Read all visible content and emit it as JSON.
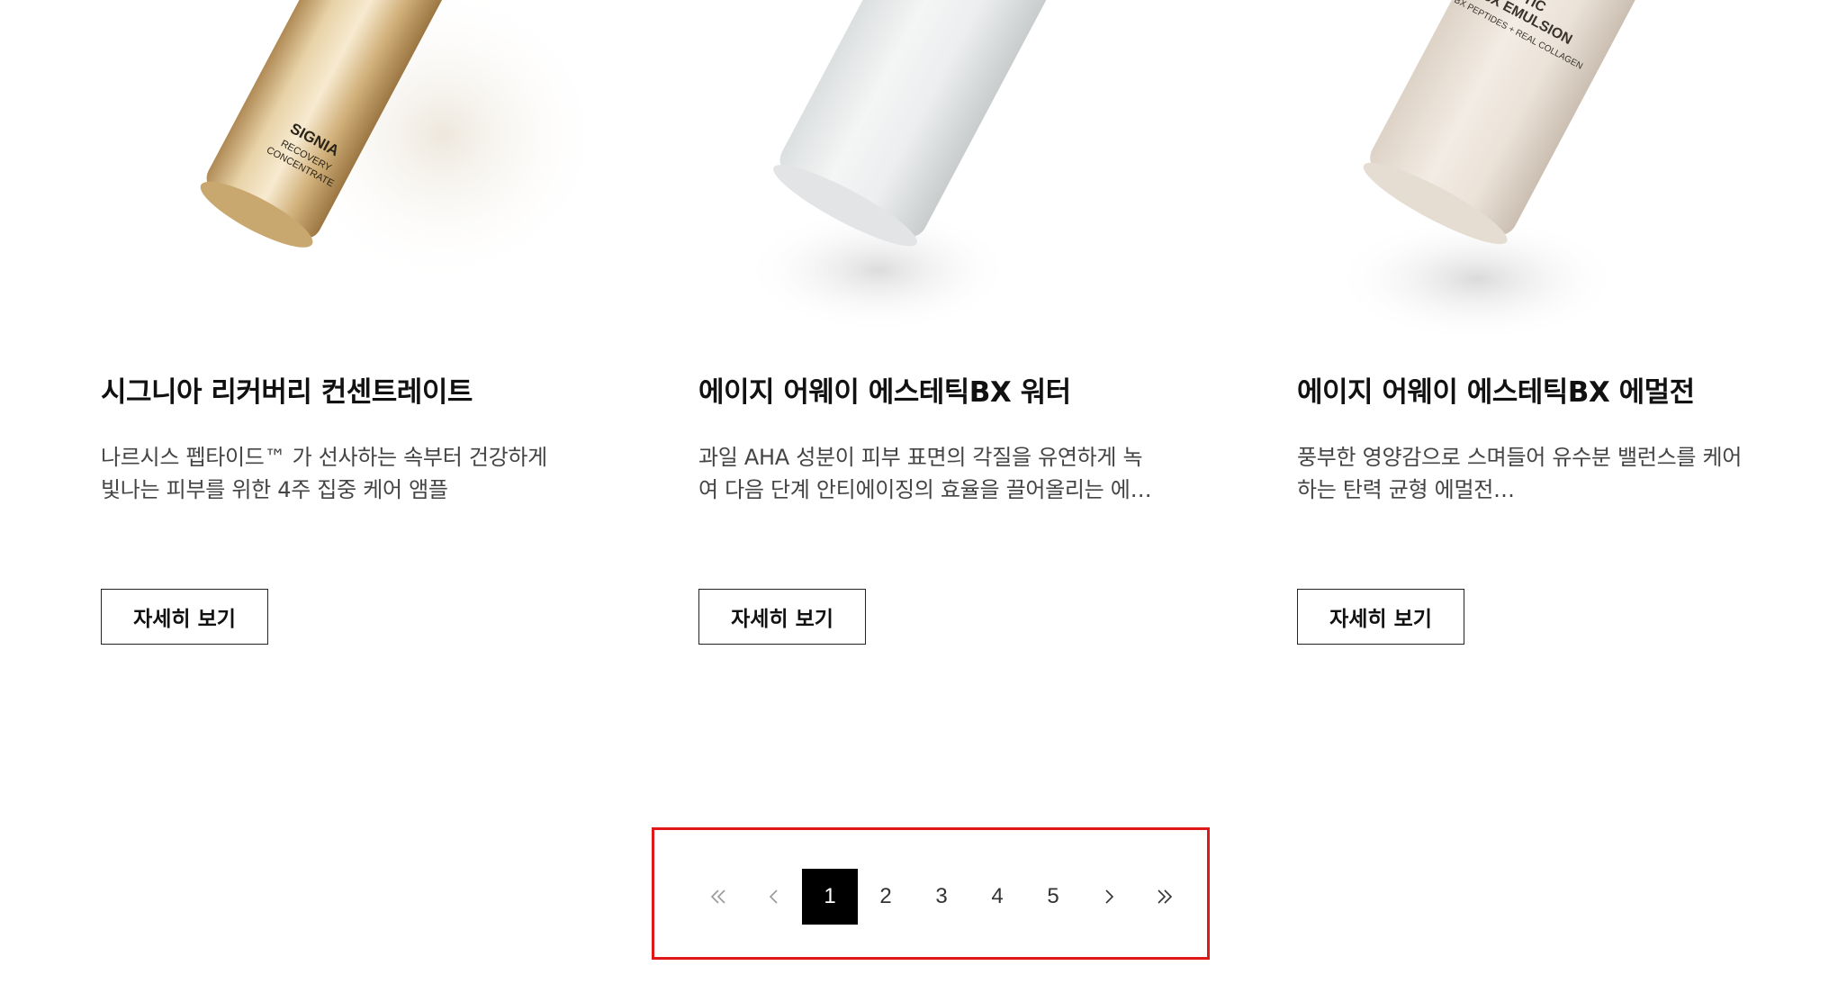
{
  "products": [
    {
      "title": "시그니아 리커버리 컨센트레이트",
      "description_lines": [
        "나르시스 펩타이드™ 가 선사하는 속부터 건강하게",
        "빛나는 피부를 위한 4주 집중 케어 앰플"
      ],
      "image_label_lines": [
        "SIGNIA",
        "RECOVERY",
        "CONCENTRATE"
      ],
      "bottle_color": "gold",
      "button_label": "자세히 보기"
    },
    {
      "title": "에이지 어웨이 에스테틱BX 워터",
      "description_lines": [
        "과일 AHA 성분이 피부 표면의 각질을 유연하게 녹",
        "여 다음 단계 안티에이징의 효율을 끌어올리는 에…"
      ],
      "image_label_lines": [],
      "bottle_color": "frosted-white",
      "button_label": "자세히 보기"
    },
    {
      "title": "에이지 어웨이 에스테틱BX 에멀전",
      "description_lines": [
        "풍부한 영양감으로 스며들어 유수분 밸런스를 케어",
        "하는 탄력 균형 에멀전…"
      ],
      "image_label_lines": [
        "TIC",
        "BX EMULSION",
        "BX PEPTIDES + REAL COLLAGEN"
      ],
      "bottle_color": "beige",
      "button_label": "자세히 보기"
    }
  ],
  "pagination": {
    "first_icon": "double-chevron-left-icon",
    "prev_icon": "chevron-left-icon",
    "pages": [
      "1",
      "2",
      "3",
      "4",
      "5"
    ],
    "current_page": "1",
    "next_icon": "chevron-right-icon",
    "last_icon": "double-chevron-right-icon"
  },
  "colors": {
    "highlight_border": "#e01818",
    "active_page_bg": "#000000",
    "active_page_text": "#ffffff",
    "text": "#111111",
    "description_text": "#444444"
  }
}
